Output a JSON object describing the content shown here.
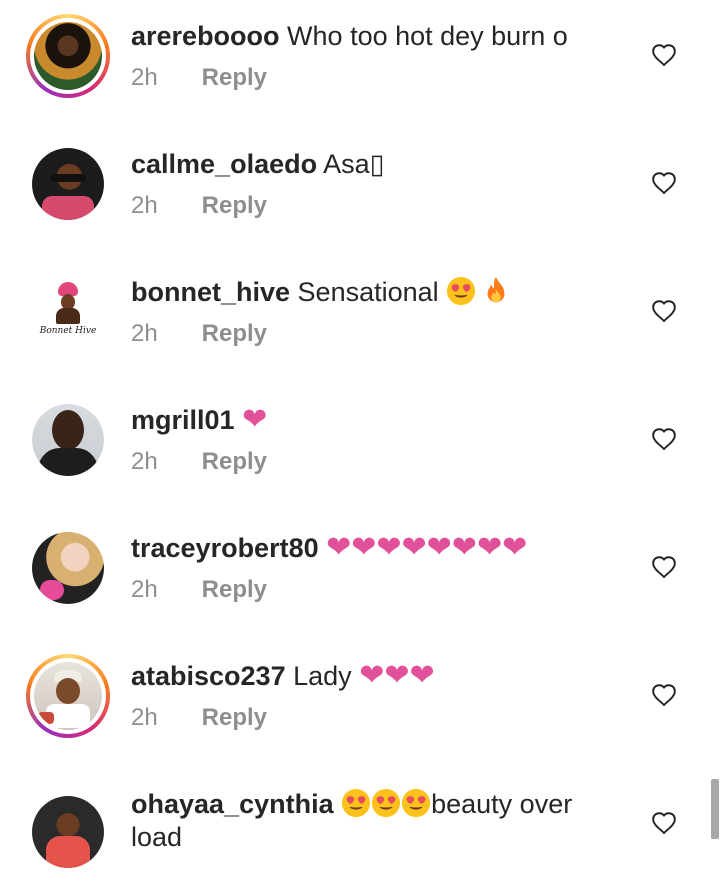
{
  "comments": [
    {
      "username": "arerebоооо",
      "text": "Who too hot dey burn o",
      "time": "2h",
      "reply": "Reply",
      "story": true
    },
    {
      "username": "callme_olaedo",
      "text": "Asa▯",
      "time": "2h",
      "reply": "Reply",
      "story": false
    },
    {
      "username": "bonnet_hive",
      "text": "Sensational",
      "time": "2h",
      "reply": "Reply",
      "story": false,
      "avatar_text": "Bonnet Hive"
    },
    {
      "username": "mgrill01",
      "text": "",
      "time": "2h",
      "reply": "Reply",
      "story": false
    },
    {
      "username": "traceyrobert80",
      "text": "",
      "time": "2h",
      "reply": "Reply",
      "story": false
    },
    {
      "username": "atabisco237",
      "text": "Lady",
      "time": "2h",
      "reply": "Reply",
      "story": true
    },
    {
      "username": "ohayaa_cynthia",
      "text": "beauty over load",
      "time": "",
      "reply": "",
      "story": false
    }
  ],
  "icons": {
    "like": "heart-outline-icon",
    "heart_emoji": "heart-emoji",
    "heart_eyes_emoji": "heart-eyes-emoji",
    "fire_emoji": "fire-emoji"
  },
  "colors": {
    "username": "#262626",
    "meta": "#8e8e8e",
    "heart_emoji": "#e0519a"
  }
}
